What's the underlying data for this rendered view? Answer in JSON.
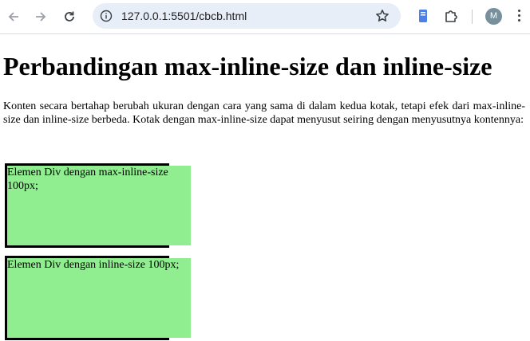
{
  "browser": {
    "url": "127.0.0.1:5501/cbcb.html",
    "avatar_letter": "M"
  },
  "page": {
    "heading": "Perbandingan max-inline-size dan inline-size",
    "description": "Konten secara bertahap berubah ukuran dengan cara yang sama di dalam kedua kotak, tetapi efek dari max-inline-size dan inline-size berbeda. Kotak dengan max-inline-size dapat menyusut seiring dengan menyusutnya kontennya:",
    "box1_text": "Elemen Div dengan max-inline-size 100px;",
    "box2_text": "Elemen Div dengan inline-size 100px;",
    "box_fill_color": "#90ee90"
  }
}
